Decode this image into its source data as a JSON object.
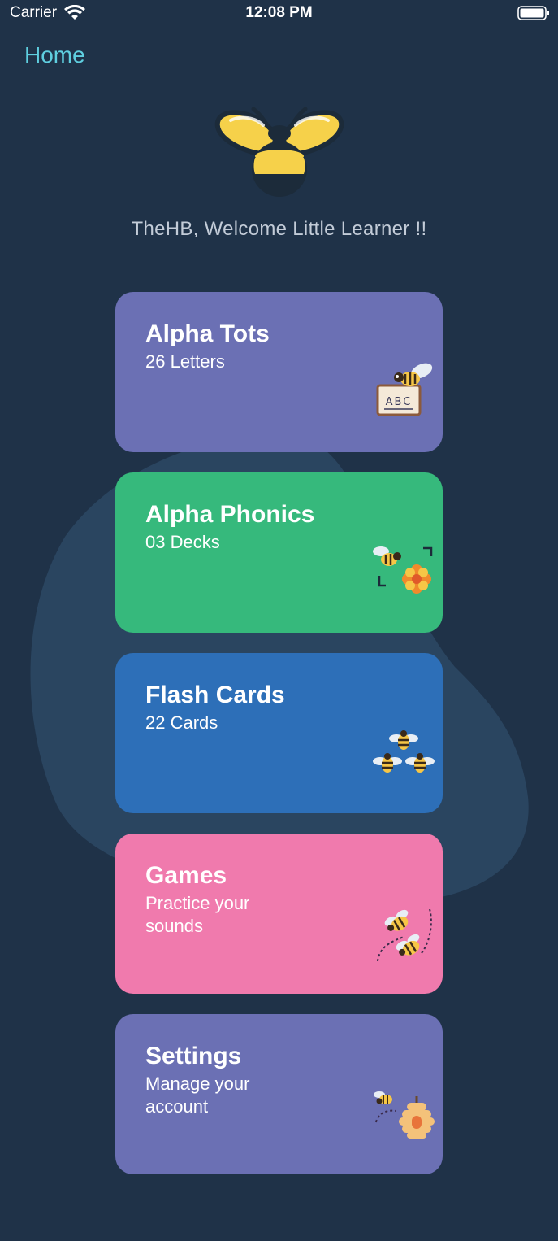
{
  "status": {
    "carrier": "Carrier",
    "time": "12:08 PM"
  },
  "nav": {
    "title": "Home"
  },
  "welcome": "TheHB, Welcome Little Learner !!",
  "cards": [
    {
      "title": "Alpha Tots",
      "subtitle": "26 Letters",
      "color": "#6b70b4",
      "icon": "bee-abc-board-icon"
    },
    {
      "title": "Alpha Phonics",
      "subtitle": "03 Decks",
      "color": "#36b97c",
      "icon": "bee-flower-icon"
    },
    {
      "title": "Flash Cards",
      "subtitle": "22 Cards",
      "color": "#2d6fb8",
      "icon": "three-bees-icon"
    },
    {
      "title": "Games",
      "subtitle": "Practice your sounds",
      "color": "#f07aad",
      "icon": "flying-bees-icon"
    },
    {
      "title": "Settings",
      "subtitle": "Manage your account",
      "color": "#6b70b4",
      "icon": "beehive-icon"
    }
  ],
  "icon_labels": {
    "board_letters": "ABC"
  },
  "colors": {
    "background": "#1f3248",
    "nav_accent": "#5fcfe0",
    "bee_yellow": "#f6d14a",
    "bee_dark": "#1c2b3a"
  }
}
